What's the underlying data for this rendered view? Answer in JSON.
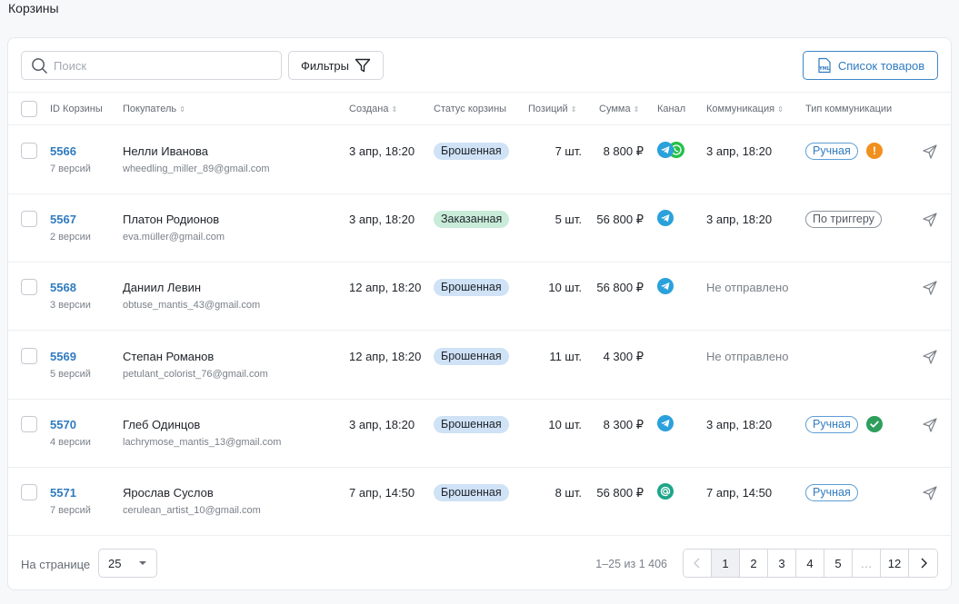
{
  "page": {
    "title": "Корзины"
  },
  "toolbar": {
    "search_placeholder": "Поиск",
    "filters_label": "Фильтры",
    "yml_icon_text": "YML",
    "yml_button_label": "Список товаров"
  },
  "table": {
    "columns": {
      "id": "ID Корзины",
      "buyer": "Покупатель",
      "created": "Создана",
      "status": "Статус корзины",
      "positions": "Позиций",
      "sum": "Сумма",
      "channel": "Канал",
      "communication": "Коммуникация",
      "comm_type": "Тип коммуникации"
    },
    "rows": [
      {
        "id": "5566",
        "versions": "7 версий",
        "name": "Нелли Иванова",
        "email": "wheedling_miller_89@gmail.com",
        "created": "3 апр, 18:20",
        "status": "Брошенная",
        "status_kind": "abandoned",
        "positions": "7 шт.",
        "sum": "8 800 ₽",
        "channels": [
          "telegram",
          "whatsapp"
        ],
        "communication": "3 апр, 18:20",
        "comm_muted": false,
        "comm_type": "Ручная",
        "comm_type_kind": "manual",
        "comm_status_icon": "warning",
        "comm_status_text": "!"
      },
      {
        "id": "5567",
        "versions": "2 версии",
        "name": "Платон Родионов",
        "email": "eva.müller@gmail.com",
        "created": "3 апр, 18:20",
        "status": "Заказанная",
        "status_kind": "ordered",
        "positions": "5 шт.",
        "sum": "56 800 ₽",
        "channels": [
          "telegram"
        ],
        "communication": "3 апр, 18:20",
        "comm_muted": false,
        "comm_type": "По триггеру",
        "comm_type_kind": "trigger",
        "comm_status_icon": "",
        "comm_status_text": ""
      },
      {
        "id": "5568",
        "versions": "3 версии",
        "name": "Даниил Левин",
        "email": "obtuse_mantis_43@gmail.com",
        "created": "12 апр, 18:20",
        "status": "Брошенная",
        "status_kind": "abandoned",
        "positions": "10 шт.",
        "sum": "56 800 ₽",
        "channels": [
          "telegram"
        ],
        "communication": "Не отправлено",
        "comm_muted": true,
        "comm_type": "",
        "comm_type_kind": "",
        "comm_status_icon": "",
        "comm_status_text": ""
      },
      {
        "id": "5569",
        "versions": "5 версий",
        "name": "Степан Романов",
        "email": "petulant_colorist_76@gmail.com",
        "created": "12 апр, 18:20",
        "status": "Брошенная",
        "status_kind": "abandoned",
        "positions": "11 шт.",
        "sum": "4 300 ₽",
        "channels": [],
        "communication": "Не отправлено",
        "comm_muted": true,
        "comm_type": "",
        "comm_type_kind": "",
        "comm_status_icon": "",
        "comm_status_text": ""
      },
      {
        "id": "5570",
        "versions": "4 версии",
        "name": "Глеб Одинцов",
        "email": "lachrymose_mantis_13@gmail.com",
        "created": "3 апр, 18:20",
        "status": "Брошенная",
        "status_kind": "abandoned",
        "positions": "10 шт.",
        "sum": "8 300 ₽",
        "channels": [
          "telegram"
        ],
        "communication": "3 апр, 18:20",
        "comm_muted": false,
        "comm_type": "Ручная",
        "comm_type_kind": "manual",
        "comm_status_icon": "success",
        "comm_status_text": ""
      },
      {
        "id": "5571",
        "versions": "7 версий",
        "name": "Ярослав Суслов",
        "email": "cerulean_artist_10@gmail.com",
        "created": "7 апр, 14:50",
        "status": "Брошенная",
        "status_kind": "abandoned",
        "positions": "8 шт.",
        "sum": "56 800 ₽",
        "channels": [
          "email"
        ],
        "communication": "7 апр, 14:50",
        "comm_muted": false,
        "comm_type": "Ручная",
        "comm_type_kind": "manual",
        "comm_status_icon": "",
        "comm_status_text": ""
      }
    ]
  },
  "footer": {
    "per_page_label": "На странице",
    "per_page_value": "25",
    "range_text": "1–25 из 1 406",
    "pages": [
      "1",
      "2",
      "3",
      "4",
      "5",
      "…",
      "12"
    ],
    "active_page": "1"
  },
  "colors": {
    "accent": "#2f7bbf",
    "telegram": "#2aa1db",
    "whatsapp": "#25c04a",
    "email": "#1fa58a",
    "warning": "#f0901e",
    "success": "#2e9e5c"
  }
}
